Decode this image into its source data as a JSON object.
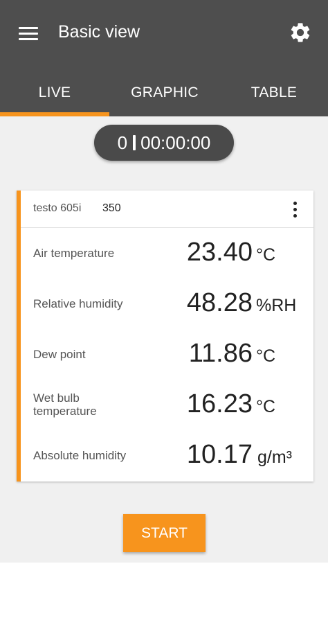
{
  "header": {
    "title": "Basic view",
    "menu_icon": "hamburger-menu-icon",
    "settings_icon": "gear-icon"
  },
  "tabs": [
    {
      "label": "LIVE",
      "active": true
    },
    {
      "label": "GRAPHIC",
      "active": false
    },
    {
      "label": "TABLE",
      "active": false
    }
  ],
  "timer": {
    "count": "0",
    "elapsed": "00:00:00"
  },
  "device": {
    "name": "testo 605i",
    "serial": "350",
    "measurements": [
      {
        "label": "Air temperature",
        "value": "23.40",
        "unit": "°C"
      },
      {
        "label": "Relative humidity",
        "value": "48.28",
        "unit": "%RH"
      },
      {
        "label": "Dew point",
        "value": "11.86",
        "unit": "°C"
      },
      {
        "label": "Wet bulb temperature",
        "value": "16.23",
        "unit": "°C"
      },
      {
        "label": "Absolute humidity",
        "value": "10.17",
        "unit": "g/m³"
      }
    ]
  },
  "actions": {
    "start_label": "START"
  },
  "colors": {
    "header_bg": "#4e4e4e",
    "accent": "#f7941d",
    "page_bg": "#f0f0f0"
  }
}
